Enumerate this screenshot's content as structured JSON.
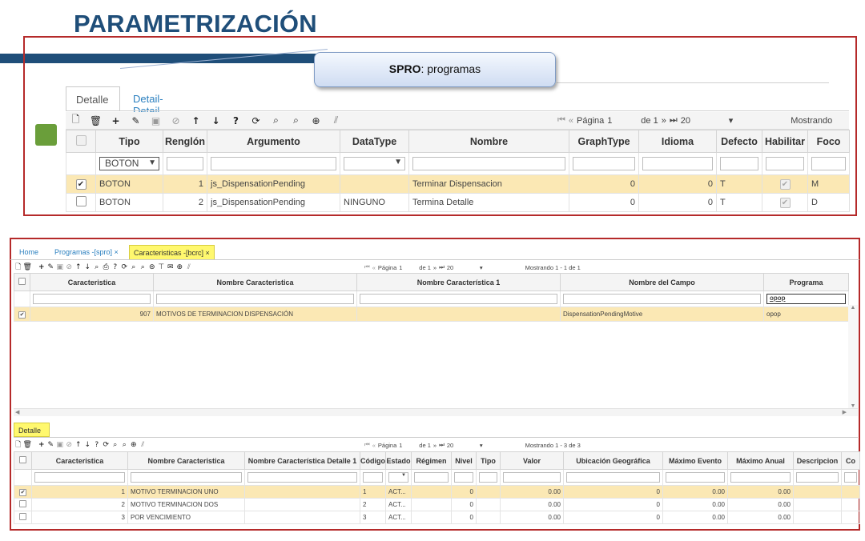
{
  "slide": {
    "title": "PARAMETRIZACIÓN",
    "callout_bold": "SPRO",
    "callout_rest": ": programas"
  },
  "top": {
    "tabs": [
      "Detalle",
      "Detail-Detail"
    ],
    "pager": {
      "page_label": "Página",
      "page": "1",
      "of": "de 1",
      "size": "20",
      "showing": "Mostrando"
    },
    "columns": [
      "Tipo",
      "Renglón",
      "Argumento",
      "DataType",
      "Nombre",
      "GraphType",
      "Idioma",
      "Defecto",
      "Habilitar",
      "Foco"
    ],
    "filter_tipo": "BOTON",
    "rows": [
      {
        "tipo": "BOTON",
        "renglon": "1",
        "argumento": "js_DispensationPending",
        "datatype": "",
        "nombre": "Terminar Dispensacion",
        "graphtype": "0",
        "idioma": "0",
        "defecto": "T",
        "foco": "M"
      },
      {
        "tipo": "BOTON",
        "renglon": "2",
        "argumento": "js_DispensationPending",
        "datatype": "NINGUNO",
        "nombre": "Termina Detalle",
        "graphtype": "0",
        "idioma": "0",
        "defecto": "T",
        "foco": "D"
      }
    ]
  },
  "bottom": {
    "tabs": [
      "Home",
      "Programas -[spro]",
      "Caracteristicas -[bcrc]"
    ],
    "pager1": {
      "page_label": "Página",
      "page": "1",
      "of": "de 1",
      "size": "20",
      "showing": "Mostrando 1 - 1 de 1"
    },
    "columns1": [
      "Caracteristica",
      "Nombre Caracteristica",
      "Nombre Característica 1",
      "Nombre del Campo",
      "Programa"
    ],
    "filter_programa": "opop",
    "rows1": [
      {
        "caracteristica": "907",
        "nombre": "MOTIVOS DE TERMINACION DISPENSACIÓN",
        "nombre1": "",
        "campo": "DispensationPendingMotive",
        "programa": "opop"
      }
    ],
    "detalle_tab": "Detalle",
    "pager2": {
      "page_label": "Página",
      "page": "1",
      "of": "de 1",
      "size": "20",
      "showing": "Mostrando 1 - 3 de 3"
    },
    "columns2": [
      "Caracteristica",
      "Nombre Caracteristica",
      "Nombre Característica Detalle 1",
      "Código",
      "Estado",
      "Régimen",
      "Nivel",
      "Tipo",
      "Valor",
      "Ubicación Geográfica",
      "Máximo Evento",
      "Máximo Anual",
      "Descripcion",
      "Co"
    ],
    "rows2": [
      {
        "caracteristica": "1",
        "nombre": "MOTIVO TERMINACION UNO",
        "detalle": "",
        "codigo": "1",
        "estado": "ACT...",
        "regimen": "",
        "nivel": "0",
        "tipo": "",
        "valor": "0.00",
        "ubicacion": "0",
        "max_evento": "0.00",
        "max_anual": "0.00"
      },
      {
        "caracteristica": "2",
        "nombre": "MOTIVO TERMINACION DOS",
        "detalle": "",
        "codigo": "2",
        "estado": "ACT...",
        "regimen": "",
        "nivel": "0",
        "tipo": "",
        "valor": "0.00",
        "ubicacion": "0",
        "max_evento": "0.00",
        "max_anual": "0.00"
      },
      {
        "caracteristica": "3",
        "nombre": "POR VENCIMIENTO",
        "detalle": "",
        "codigo": "3",
        "estado": "ACT...",
        "regimen": "",
        "nivel": "0",
        "tipo": "",
        "valor": "0.00",
        "ubicacion": "0",
        "max_evento": "0.00",
        "max_anual": "0.00"
      }
    ]
  },
  "colors": {
    "title": "#1f4e79",
    "frame": "#b52a2a",
    "selected_row": "#fbe8b4",
    "active_tab": "#fff86e",
    "link": "#2a7fbf"
  }
}
